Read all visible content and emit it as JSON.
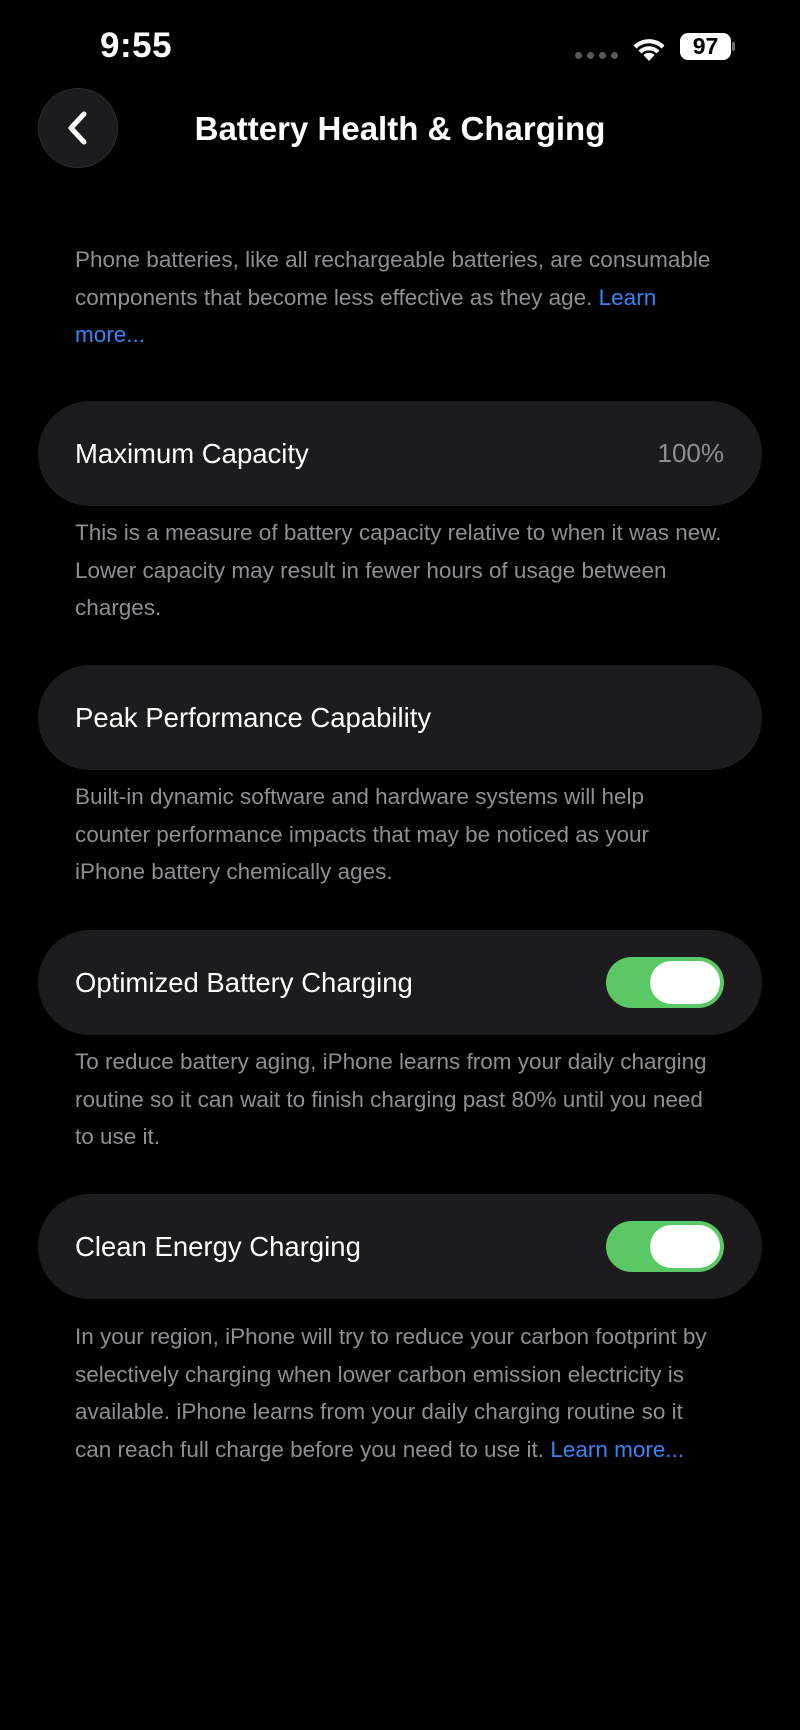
{
  "status_bar": {
    "time": "9:55",
    "battery_level": "97"
  },
  "header": {
    "title": "Battery Health & Charging"
  },
  "intro": {
    "text": "Phone batteries, like all rechargeable batteries, are consumable components that become less effective as they age.",
    "link": "Learn more..."
  },
  "maximum_capacity": {
    "label": "Maximum Capacity",
    "value": "100%",
    "description": "This is a measure of battery capacity relative to when it was new. Lower capacity may result in fewer hours of usage between charges."
  },
  "peak_performance": {
    "label": "Peak Performance Capability",
    "description": "Built-in dynamic software and hardware systems will help counter performance impacts that may be noticed as your iPhone battery chemically ages."
  },
  "optimized_charging": {
    "label": "Optimized Battery Charging",
    "enabled": true,
    "description": "To reduce battery aging, iPhone learns from your daily charging routine so it can wait to finish charging past 80% until you need to use it."
  },
  "clean_energy": {
    "label": "Clean Energy Charging",
    "enabled": true,
    "description": "In your region, iPhone will try to reduce your carbon footprint by selectively charging when lower carbon emission electricity is available. iPhone learns from your daily charging routine so it can reach full charge before you need to use it.",
    "link": "Learn more..."
  },
  "colors": {
    "toggle_on": "#5ac864",
    "link": "#3b82f6",
    "cell_bg": "#1c1c1e",
    "secondary_text": "#8e8e93"
  },
  "icons": {
    "back": "chevron-left-icon",
    "wifi": "wifi-icon",
    "battery": "battery-icon",
    "signal": "signal-dots-icon"
  }
}
